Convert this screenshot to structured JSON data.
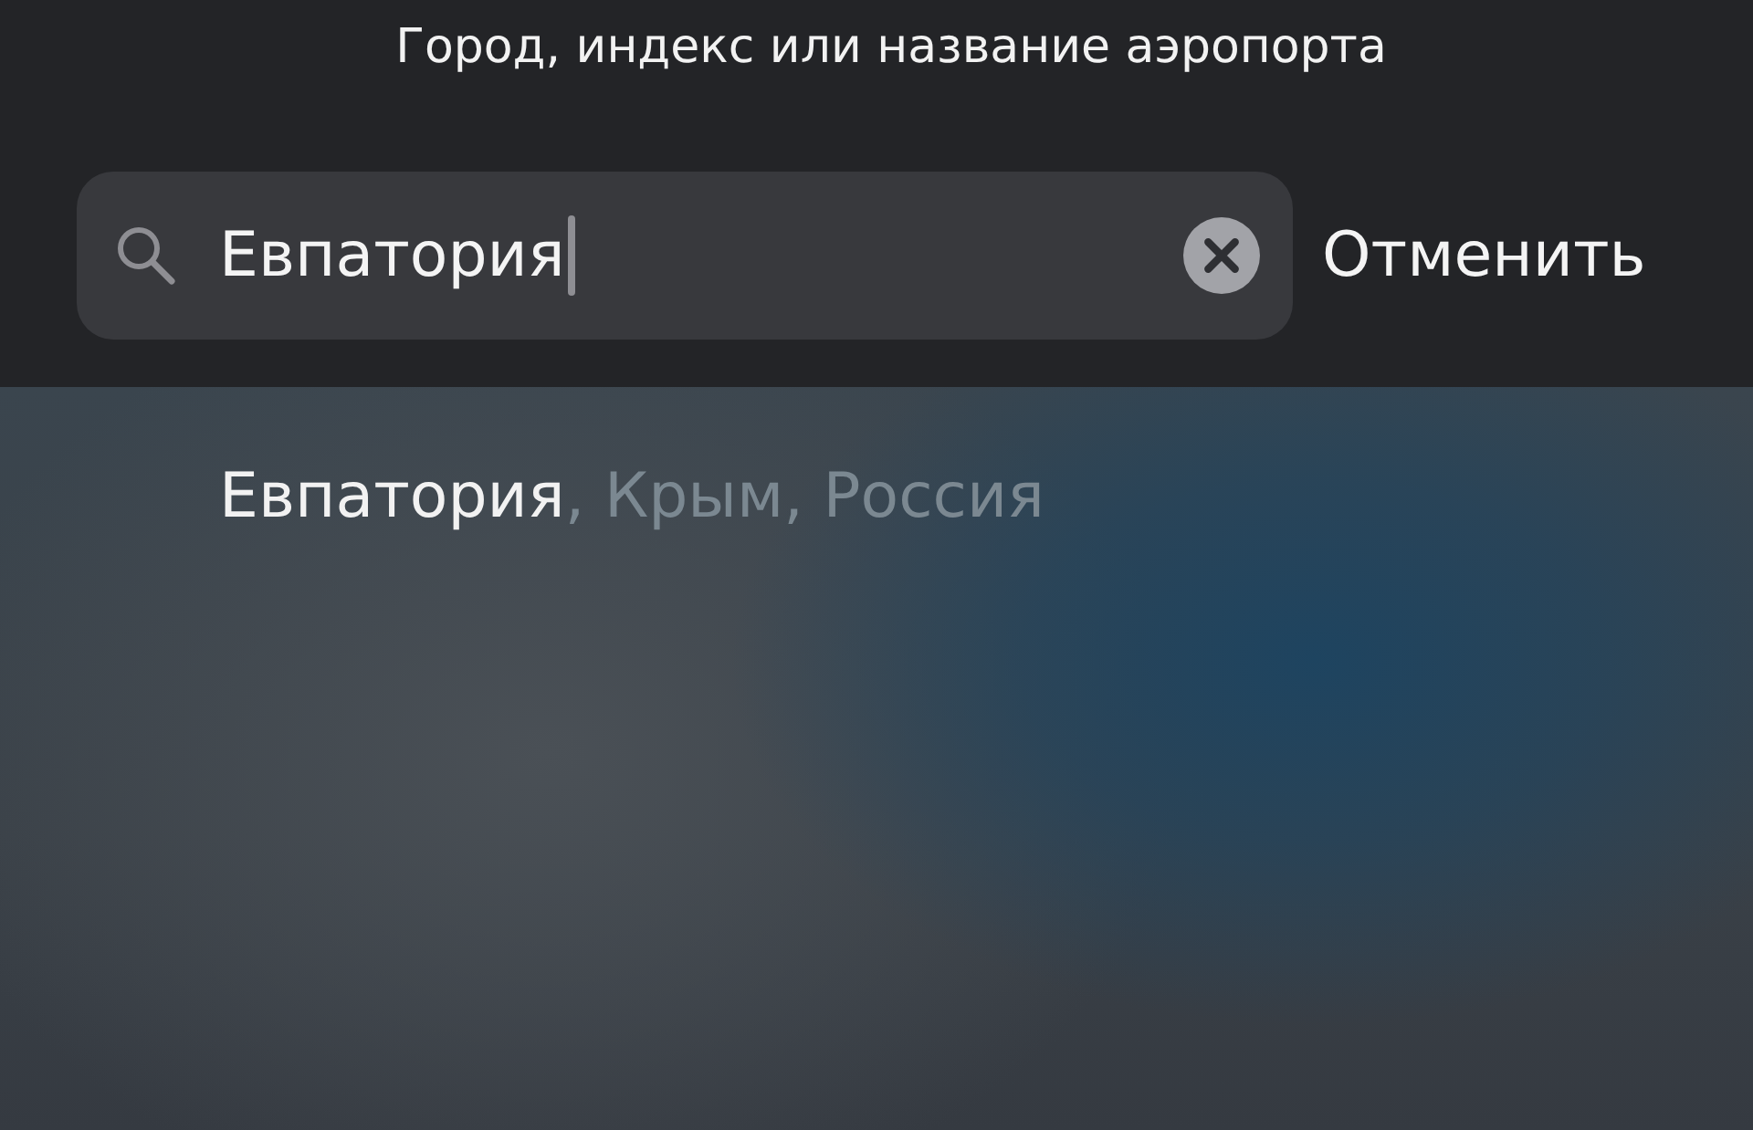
{
  "header": {
    "title": "Город, индекс или название аэропорта"
  },
  "search": {
    "value": "Евпатория",
    "cancel": "Отменить"
  },
  "results": [
    {
      "match": "Евпатория",
      "rest": ", Крым, Россия"
    }
  ]
}
